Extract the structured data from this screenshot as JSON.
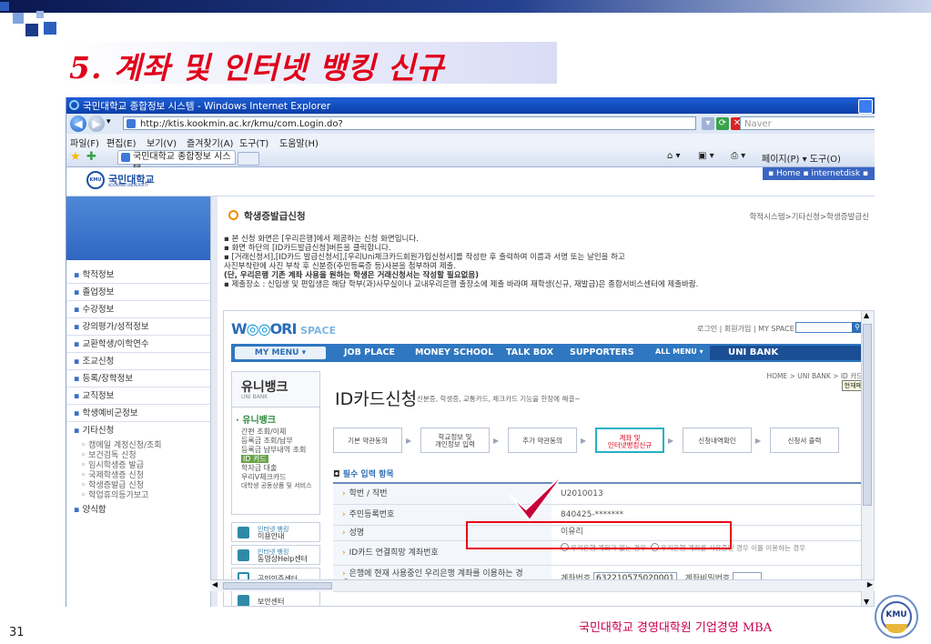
{
  "slide": {
    "title": "5. 계좌 및 인터넷 뱅킹 신규",
    "page_number": "31",
    "footer": "국민대학교 경영대학원 기업경영 MBA",
    "footer_logo": "KMU",
    "accent_color": "#e0001b"
  },
  "browser": {
    "window_title": "국민대학교 종합정보 시스템 - Windows Internet Explorer",
    "address": "http://ktis.kookmin.ac.kr/kmu/com.Login.do?",
    "search_placeholder": "Naver",
    "menu": [
      "파일(F)",
      "편집(E)",
      "보기(V)",
      "즐겨찾기(A)",
      "도구(T)",
      "도움말(H)"
    ],
    "tab": "국민대학교 종합정보 시스템",
    "tools": "페이지(P) ▾  도구(O)"
  },
  "site": {
    "logo": "국민대학교",
    "logo_sub": "KOOKMIN UNIVERSITY",
    "home_links": "▪ Home  ▪ internetdisk  ▪ L",
    "nav": [
      "학적정보",
      "졸업정보",
      "수강정보",
      "강의평가/성적정보",
      "교환학생/이학연수",
      "조교신청",
      "등록/장학정보",
      "교직정보",
      "학생예비군정보",
      "기타신청"
    ],
    "subnav": [
      "캠메일 계정신청/조회",
      "보건검독 신청",
      "임시학생증 발급",
      "국제학생증 신청",
      "학생증발급 신청",
      "학업휴의등가보고"
    ],
    "nav_last": "양식함",
    "content_title": "학생증발급신청",
    "breadcrumb": "학적시스템>기타신청>학생증발급신",
    "notices": [
      "▪ 본 신청 화면은 [우리은행]에서 제공하는 신청 화면입니다.",
      "▪ 화면 하단의 [ID카드발급신청]버튼을 클릭합니다.",
      "▪ [거래신청서],[ID카드 발급신청서],[우리Uni체크카드회원가입신청서]를 작성한 후 출력하여 이름과 서명 또는 날인을 하고",
      "   사진부착란에 사진 부착 후 신분증(주민등록증 등)사본을 첨부하여 제출.",
      "   (단, 우리은행 기존 계좌 사용을 원하는 학생은 거래신청서는 작성할 필요없음)",
      "▪ 제출장소 : 신입생 및 편입생은 해당 학부(과)사무실이나 교내우리은행 출장소에 제출 바라며 재학생(신규, 재발급)은 종합서비스센터에 제출바람."
    ]
  },
  "woori": {
    "logo_w": "W",
    "logo_mid": "ORI",
    "logo_space": "SPACE",
    "top_links": "로그인 | 회원가입 | MY SPACE",
    "nav": [
      "MY MENU ▾",
      "JOB PLACE",
      "MONEY SCHOOL",
      "TALK BOX",
      "SUPPORTERS",
      "ALL MENU ▾",
      "UNI BANK"
    ],
    "side_title": "유니뱅크",
    "side_sub": "UNI BANK",
    "side_head": "· 유니뱅크",
    "side_items": [
      "간편 조회/이체",
      "등록금 조회/납부",
      "등록금 납부내역 조회",
      "ID 카드",
      "학자금 대출",
      "우리V체크카드",
      "대학생 공동상품 및 서비스"
    ],
    "quick": [
      {
        "small": "인터넷 뱅킹",
        "label": "이용안내"
      },
      {
        "small": "인터넷 뱅킹",
        "label": "동영상Help센터"
      },
      {
        "small": "",
        "label": "공인인증센터"
      },
      {
        "small": "",
        "label": "보안센터"
      }
    ],
    "breadcrumb": "HOME > UNI BANK > ID 카드",
    "tooltip": "현재페",
    "page_title": "ID카드신청",
    "page_sub": "신분증, 학생증, 교통카드, 체크카드 기능을 한장에 해결~",
    "steps": [
      "기본 약관동의",
      "학교정보 및\n개인정보 입력",
      "추가 약관동의",
      "계좌 및\n인터넷뱅킹신규",
      "신청내역확인",
      "신청서 출력"
    ],
    "required_title": "필수 입력 항목",
    "fields": [
      {
        "label": "학번 / 직번",
        "value": "U2010013"
      },
      {
        "label": "주민등록번호",
        "value": "840425-*******"
      },
      {
        "label": "성명",
        "value": "이유리"
      },
      {
        "label": "ID카드 연결희망 계좌번호",
        "option1": "우리은행 계좌가 없는 경우",
        "option2": "우리은행 계좌를 사용중인 경우 이를 이용하는 경우"
      },
      {
        "label": "은행에 현재 사용중인 우리은행 계좌를 이용하는 경우",
        "account_label": "계좌번호",
        "account": "632210575020001",
        "pw_label": "계좌비밀번호"
      }
    ]
  }
}
